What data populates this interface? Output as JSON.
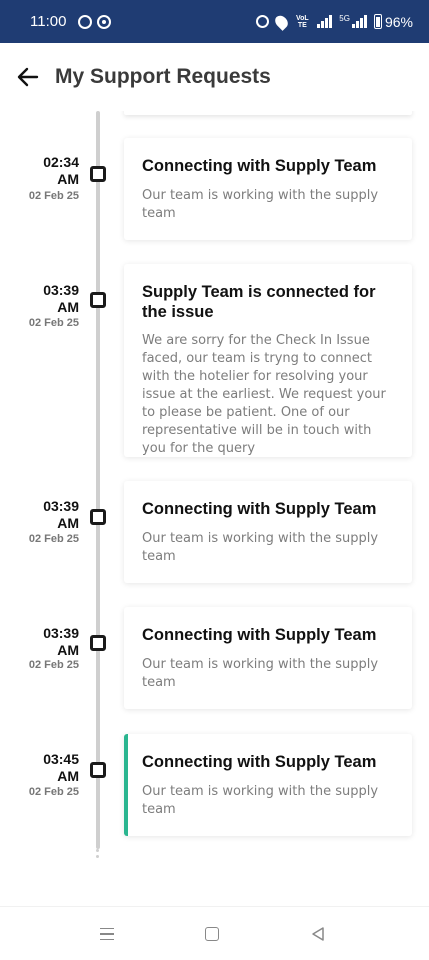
{
  "status_bar": {
    "time": "11:00",
    "network_label": "5G",
    "volte_label": "VoLTE",
    "battery": "96%",
    "icons": [
      "whatsapp-icon",
      "call-icon",
      "alarm-icon",
      "location-icon",
      "volte-icon",
      "signal-icon",
      "battery-icon"
    ]
  },
  "header": {
    "title": "My Support Requests",
    "back_icon": "arrow-left-icon"
  },
  "timeline": {
    "events": [
      {
        "time_hm": "02:34",
        "time_ampm": "AM",
        "date": "02 Feb 25",
        "title": "Connecting with Supply Team",
        "description": "Our team is working with the supply team",
        "active": false
      },
      {
        "time_hm": "03:39",
        "time_ampm": "AM",
        "date": "02 Feb 25",
        "title": "Supply Team is connected for the issue",
        "description": "We are sorry for the Check In Issue faced, our team is tryng to connect with the hotelier for resolving your issue at the earliest. We request your to please be patient. One of our representative will be in touch with you for the query",
        "active": false
      },
      {
        "time_hm": "03:39",
        "time_ampm": "AM",
        "date": "02 Feb 25",
        "title": "Connecting with Supply Team",
        "description": "Our team is working with the supply team",
        "active": false
      },
      {
        "time_hm": "03:39",
        "time_ampm": "AM",
        "date": "02 Feb 25",
        "title": "Connecting with Supply Team",
        "description": "Our team is working with the supply team",
        "active": false
      },
      {
        "time_hm": "03:45",
        "time_ampm": "AM",
        "date": "02 Feb 25",
        "title": "Connecting with Supply Team",
        "description": "Our team is working with the supply team",
        "active": true
      }
    ],
    "accent_color": "#2ab58f"
  },
  "nav_bar": {
    "icons": [
      "menu-icon",
      "home-icon",
      "back-triangle-icon"
    ]
  },
  "colors": {
    "status_bar_bg": "#1f3c73",
    "title_text": "#3a3a3a",
    "description_text": "#7d7d7d"
  }
}
